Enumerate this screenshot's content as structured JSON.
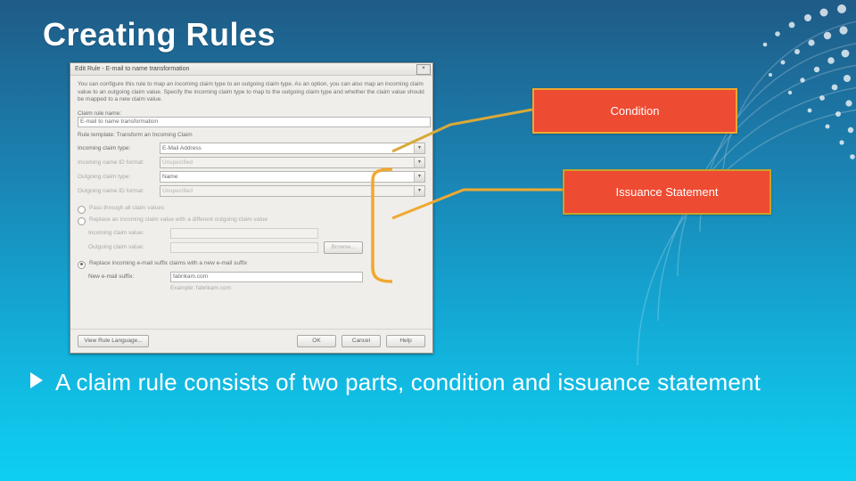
{
  "slide": {
    "title": "Creating Rules",
    "bullet": "A claim rule consists of two parts, condition and issuance statement"
  },
  "callouts": {
    "condition": "Condition",
    "issuance": "Issuance Statement"
  },
  "dialog": {
    "titlebar": "Edit Rule - E-mail to name transformation",
    "close_label": "×",
    "description": "You can configure this rule to map an incoming claim type to an outgoing claim type. As an option, you can also map an incoming claim value to an outgoing claim value. Specify the incoming claim type to map to the outgoing claim type and whether the claim value should be mapped to a new claim value.",
    "fields": {
      "rule_name_label": "Claim rule name:",
      "rule_name_value": "E-mail to name transformation",
      "rule_template_label": "Rule template: Transform an Incoming Claim",
      "incoming_claim_type_label": "Incoming claim type:",
      "incoming_claim_type_value": "E-Mail Address",
      "incoming_name_id_format_label": "Incoming name ID format:",
      "incoming_name_id_format_value": "Unspecified",
      "outgoing_claim_type_label": "Outgoing claim type:",
      "outgoing_claim_type_value": "Name",
      "outgoing_name_id_format_label": "Outgoing name ID format:",
      "outgoing_name_id_format_value": "Unspecified"
    },
    "radios": [
      {
        "label": "Pass through all claim values",
        "checked": false
      },
      {
        "label": "Replace an incoming claim value with a different outgoing claim value",
        "checked": false
      },
      {
        "label": "Replace incoming e-mail suffix claims with a new e-mail suffix",
        "checked": true
      }
    ],
    "replace_fields": {
      "incoming_claim_value_label": "Incoming claim value:",
      "incoming_claim_value": "",
      "outgoing_claim_value_label": "Outgoing claim value:",
      "outgoing_claim_value": "",
      "browse_button": "Browse..."
    },
    "suffix_fields": {
      "new_email_suffix_label": "New e-mail suffix:",
      "new_email_suffix_value": "fabrikam.com",
      "example_text": "Example: fabrikam.com"
    },
    "buttons": {
      "view_rule_language": "View Rule Language...",
      "ok": "OK",
      "cancel": "Cancel",
      "help": "Help"
    }
  },
  "colors": {
    "callout_fill": "#ee4b33",
    "callout_border_condition": "#f0a830",
    "callout_border_issuance": "#c9a227",
    "connector": "#f0a830",
    "slide_bg_top": "#1f5b86",
    "slide_bg_bottom": "#0ecff2"
  }
}
